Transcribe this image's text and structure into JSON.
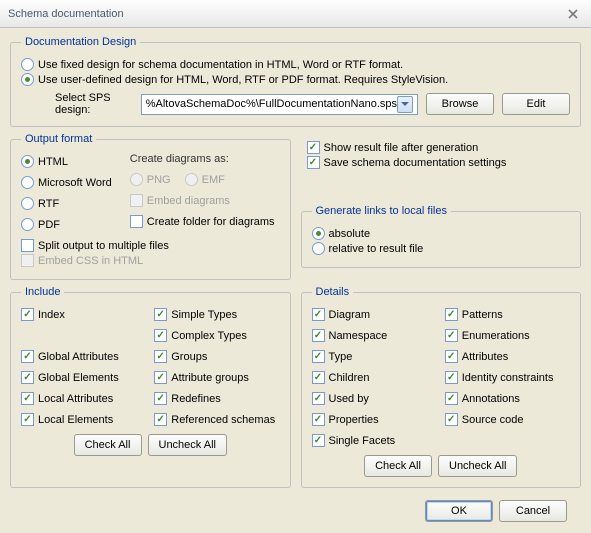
{
  "window": {
    "title": "Schema documentation"
  },
  "docDesign": {
    "legend": "Documentation Design",
    "fixedLabel": "Use fixed design for schema documentation in HTML, Word or RTF format.",
    "userLabel": "Use user-defined design for HTML, Word, RTF or PDF format. Requires StyleVision.",
    "spsLabel": "Select SPS design:",
    "spsValue": "%AltovaSchemaDoc%\\FullDocumentationNano.sps",
    "browse": "Browse",
    "edit": "Edit"
  },
  "outputFormat": {
    "legend": "Output format",
    "html": "HTML",
    "word": "Microsoft Word",
    "rtf": "RTF",
    "pdf": "PDF",
    "createDiagramsAs": "Create diagrams as:",
    "png": "PNG",
    "emf": "EMF",
    "embedDiagrams": "Embed diagrams",
    "createFolder": "Create folder for diagrams",
    "splitOutput": "Split output to multiple files",
    "embedCss": "Embed CSS in HTML"
  },
  "options": {
    "showResult": "Show result file after generation",
    "saveSettings": "Save schema documentation settings"
  },
  "links": {
    "legend": "Generate links to local files",
    "absolute": "absolute",
    "relative": "relative to result file"
  },
  "include": {
    "legend": "Include",
    "index": "Index",
    "globalAttributes": "Global Attributes",
    "globalElements": "Global Elements",
    "localAttributes": "Local Attributes",
    "localElements": "Local Elements",
    "simpleTypes": "Simple Types",
    "complexTypes": "Complex Types",
    "groups": "Groups",
    "attributeGroups": "Attribute groups",
    "redefines": "Redefines",
    "referencedSchemas": "Referenced schemas",
    "checkAll": "Check All",
    "uncheckAll": "Uncheck All"
  },
  "details": {
    "legend": "Details",
    "diagram": "Diagram",
    "namespace": "Namespace",
    "type": "Type",
    "children": "Children",
    "usedBy": "Used by",
    "properties": "Properties",
    "singleFacets": "Single Facets",
    "patterns": "Patterns",
    "enumerations": "Enumerations",
    "attributes": "Attributes",
    "identityConstraints": "Identity constraints",
    "annotations": "Annotations",
    "sourceCode": "Source code",
    "checkAll": "Check All",
    "uncheckAll": "Uncheck All"
  },
  "footer": {
    "ok": "OK",
    "cancel": "Cancel"
  }
}
